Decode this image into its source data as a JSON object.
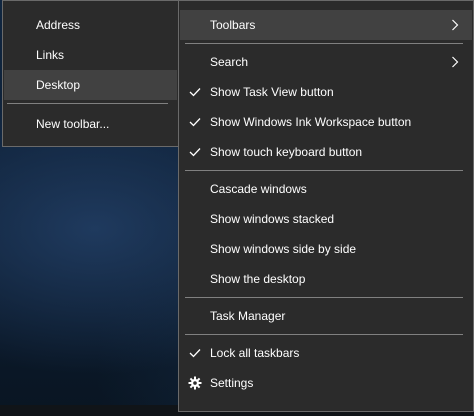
{
  "submenu": {
    "items": [
      {
        "label": "Address"
      },
      {
        "label": "Links"
      },
      {
        "label": "Desktop"
      },
      {
        "label": "New toolbar..."
      }
    ]
  },
  "context_menu": {
    "toolbars": "Toolbars",
    "search": "Search",
    "show_task_view": "Show Task View button",
    "show_ink_workspace": "Show Windows Ink Workspace button",
    "show_touch_keyboard": "Show touch keyboard button",
    "cascade": "Cascade windows",
    "stacked": "Show windows stacked",
    "side_by_side": "Show windows side by side",
    "show_desktop": "Show the desktop",
    "task_manager": "Task Manager",
    "lock_taskbars": "Lock all taskbars",
    "settings": "Settings"
  },
  "colors": {
    "menu_bg": "#2b2b2b",
    "hover_bg": "#414141",
    "text": "#ffffff",
    "separator": "#808080"
  },
  "icons": {
    "submenu_arrow": "chevron-right-icon",
    "checked": "checkmark-icon",
    "settings": "gear-icon"
  }
}
